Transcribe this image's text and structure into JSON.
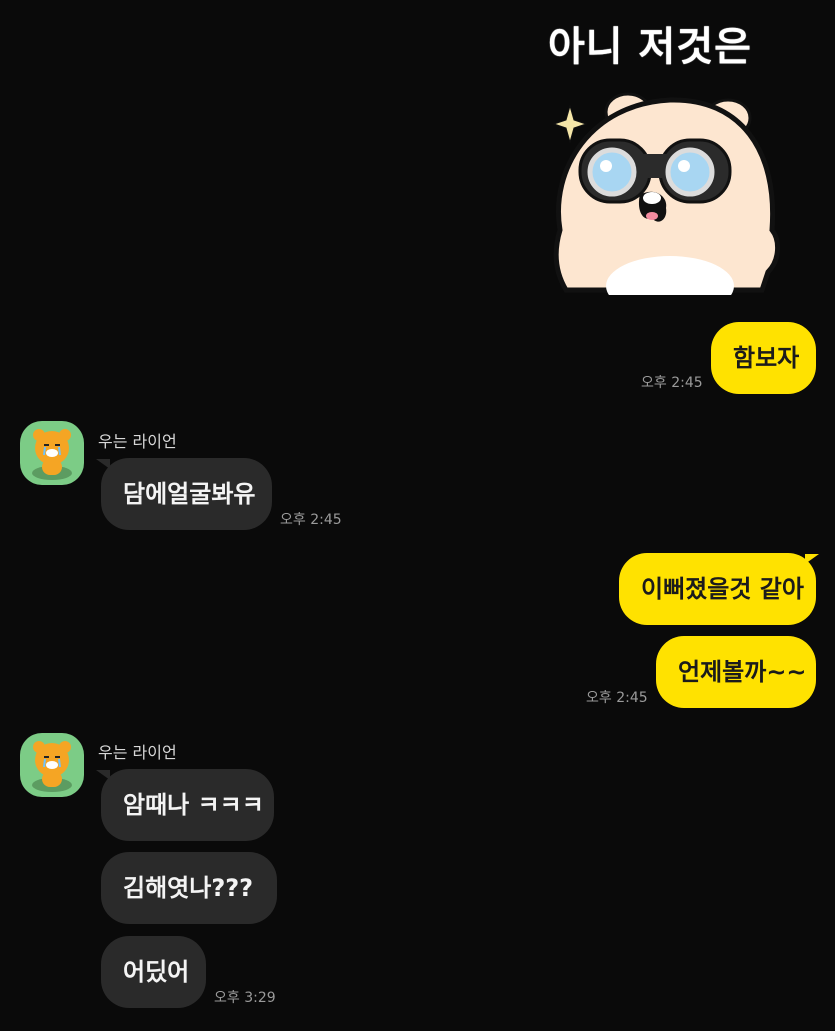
{
  "sticker": {
    "caption": "아니 저것은",
    "icon": "bear-binoculars-sticker"
  },
  "colors": {
    "background": "#0a0a0a",
    "my_bubble": "#ffe200",
    "their_bubble": "#2a2a2a",
    "avatar_bg": "#7ccc86"
  },
  "messages": {
    "m1": {
      "text": "함보자",
      "time": "오후 2:45"
    },
    "group1": {
      "sender": "우는 라이언",
      "avatar_icon": "crying-lion-avatar",
      "m1": {
        "text": "담에얼굴봐유",
        "time": "오후 2:45"
      }
    },
    "m2": {
      "text": "이뻐졌을것 같아"
    },
    "m3": {
      "text": "언제볼까~~",
      "time": "오후 2:45"
    },
    "group2": {
      "sender": "우는 라이언",
      "avatar_icon": "crying-lion-avatar",
      "m1": {
        "text": "암때나 ㅋㅋㅋ"
      },
      "m2": {
        "text": "김해엿나???"
      },
      "m3": {
        "text": "어딨어",
        "time": "오후 3:29"
      }
    }
  }
}
